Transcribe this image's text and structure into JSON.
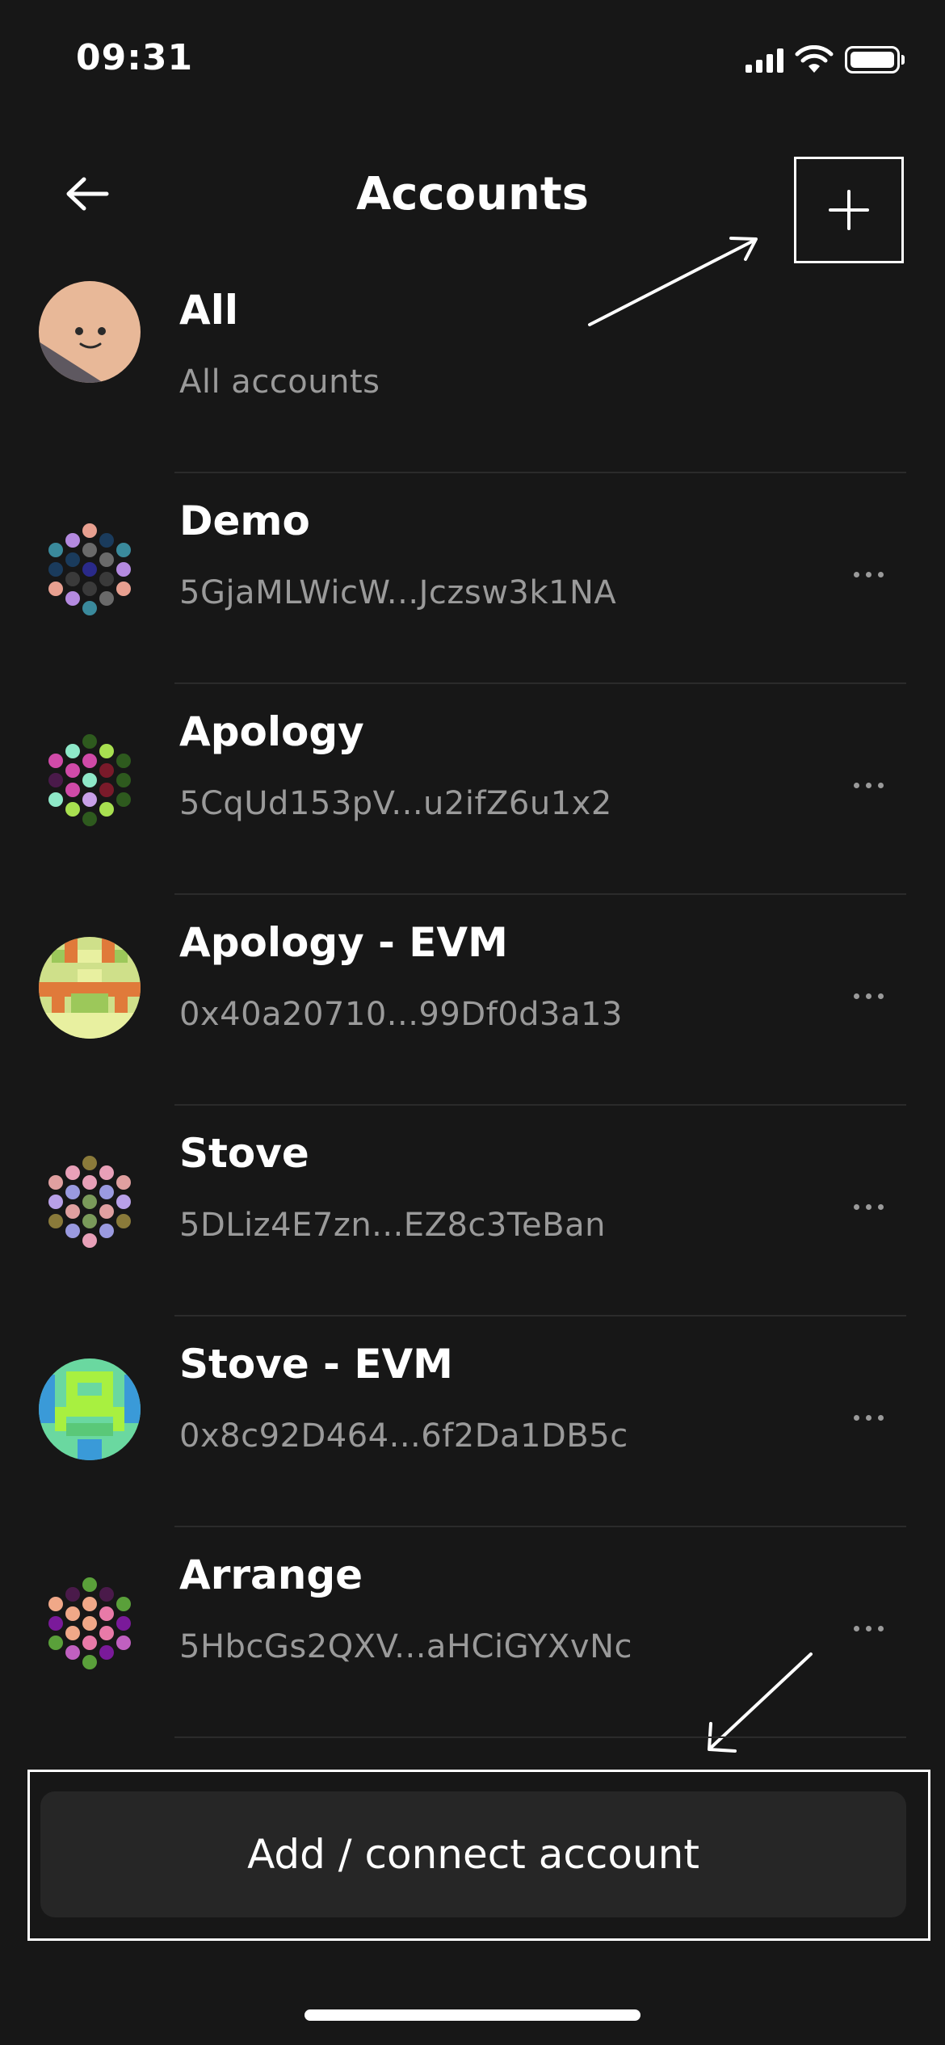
{
  "status_bar": {
    "time": "09:31"
  },
  "header": {
    "title": "Accounts"
  },
  "accounts": [
    {
      "name": "All",
      "subtitle": "All accounts",
      "avatar": "face-avatar",
      "has_menu": false
    },
    {
      "name": "Demo",
      "subtitle": "5GjaMLWicW...Jczsw3k1NA",
      "avatar": "polkadot-identicon",
      "palette": [
        "#e8a090",
        "#3a8a9c",
        "#b48ae0",
        "#1a3b5c",
        "#6a6a6a",
        "#2a2a8a"
      ],
      "has_menu": true
    },
    {
      "name": "Apology",
      "subtitle": "5CqUd153pV...u2ifZ6u1x2",
      "avatar": "polkadot-identicon",
      "palette": [
        "#2e5a1e",
        "#d04aa8",
        "#8ee8c8",
        "#7a1a2a",
        "#c8a0e8",
        "#a8e050"
      ],
      "has_menu": true
    },
    {
      "name": "Apology - EVM",
      "subtitle": "0x40a20710...99Df0d3a13",
      "avatar": "evm-blockie",
      "palette": [
        "#cfe08a",
        "#e07a3a",
        "#9cc85a",
        "#e8f0a0"
      ],
      "has_menu": true
    },
    {
      "name": "Stove",
      "subtitle": "5DLiz4E7zn...EZ8c3TeBan",
      "avatar": "polkadot-identicon",
      "palette": [
        "#9a9ae0",
        "#e8a0b8",
        "#8a7a3a",
        "#7a9a5a",
        "#b8a0e8",
        "#e0a0a0"
      ],
      "has_menu": true
    },
    {
      "name": "Stove - EVM",
      "subtitle": "0x8c92D464...6f2Da1DB5c",
      "avatar": "evm-blockie",
      "palette": [
        "#6ad8a0",
        "#a8f040",
        "#3a9ad8",
        "#5ac878"
      ],
      "has_menu": true
    },
    {
      "name": "Arrange",
      "subtitle": "5HbcGs2QXV...aHCiGYXvNc",
      "avatar": "polkadot-identicon",
      "palette": [
        "#f0a888",
        "#7a1a9a",
        "#5aa03a",
        "#e87aa8",
        "#c060c0",
        "#4a1a4a"
      ],
      "has_menu": true
    }
  ],
  "footer": {
    "add_connect_label": "Add / connect account"
  },
  "colors": {
    "background": "#171717",
    "secondary_text": "#9a9a9a",
    "button_bg": "#262626"
  }
}
